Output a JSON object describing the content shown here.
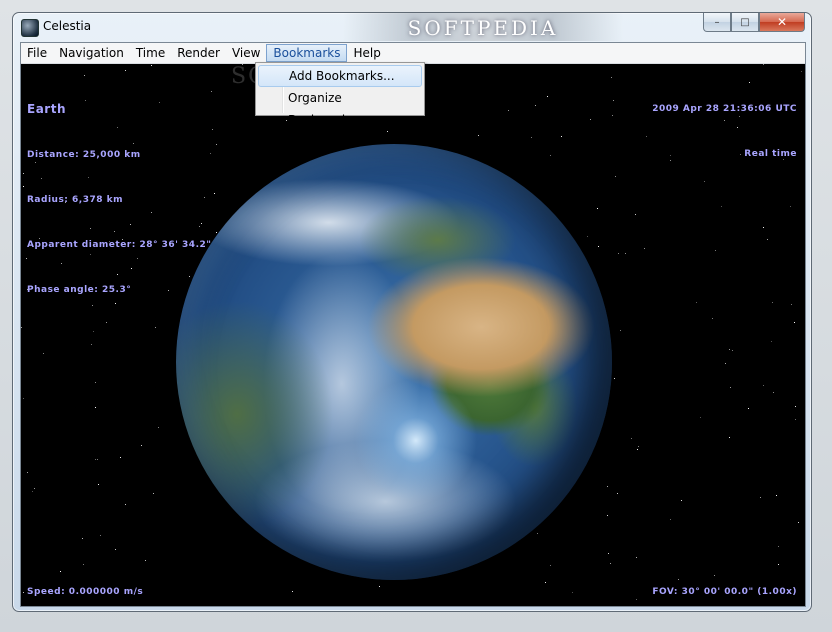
{
  "window": {
    "title": "Celestia",
    "watermark": "SOFTPEDIA",
    "controls": {
      "minimize": "–",
      "maximize": "□",
      "close": "✕"
    }
  },
  "menu": {
    "file": "File",
    "navigation": "Navigation",
    "time": "Time",
    "render": "Render",
    "view": "View",
    "bookmarks": "Bookmarks",
    "help": "Help"
  },
  "bookmarks_menu": {
    "items": [
      {
        "label": "Add Bookmarks..."
      },
      {
        "label": "Organize Bookmarks..."
      }
    ]
  },
  "hud": {
    "top_left": {
      "name": "Earth",
      "distance": "Distance: 25,000 km",
      "radius": "Radius: 6,378 km",
      "apparent_diameter": "Apparent diameter: 28° 36' 34.2\"",
      "phase_angle": "Phase angle: 25.3°"
    },
    "top_right": {
      "date": "2009 Apr 28 21:36:06 UTC",
      "speed_state": "Real time"
    },
    "bottom_left": "Speed: 0.000000 m/s",
    "bottom_right": "FOV: 30° 00' 00.0\" (1.00x)"
  },
  "colors": {
    "hud_text": "#a9a5ff",
    "space": "#000000",
    "menu_highlight": "#1a4f9b"
  }
}
